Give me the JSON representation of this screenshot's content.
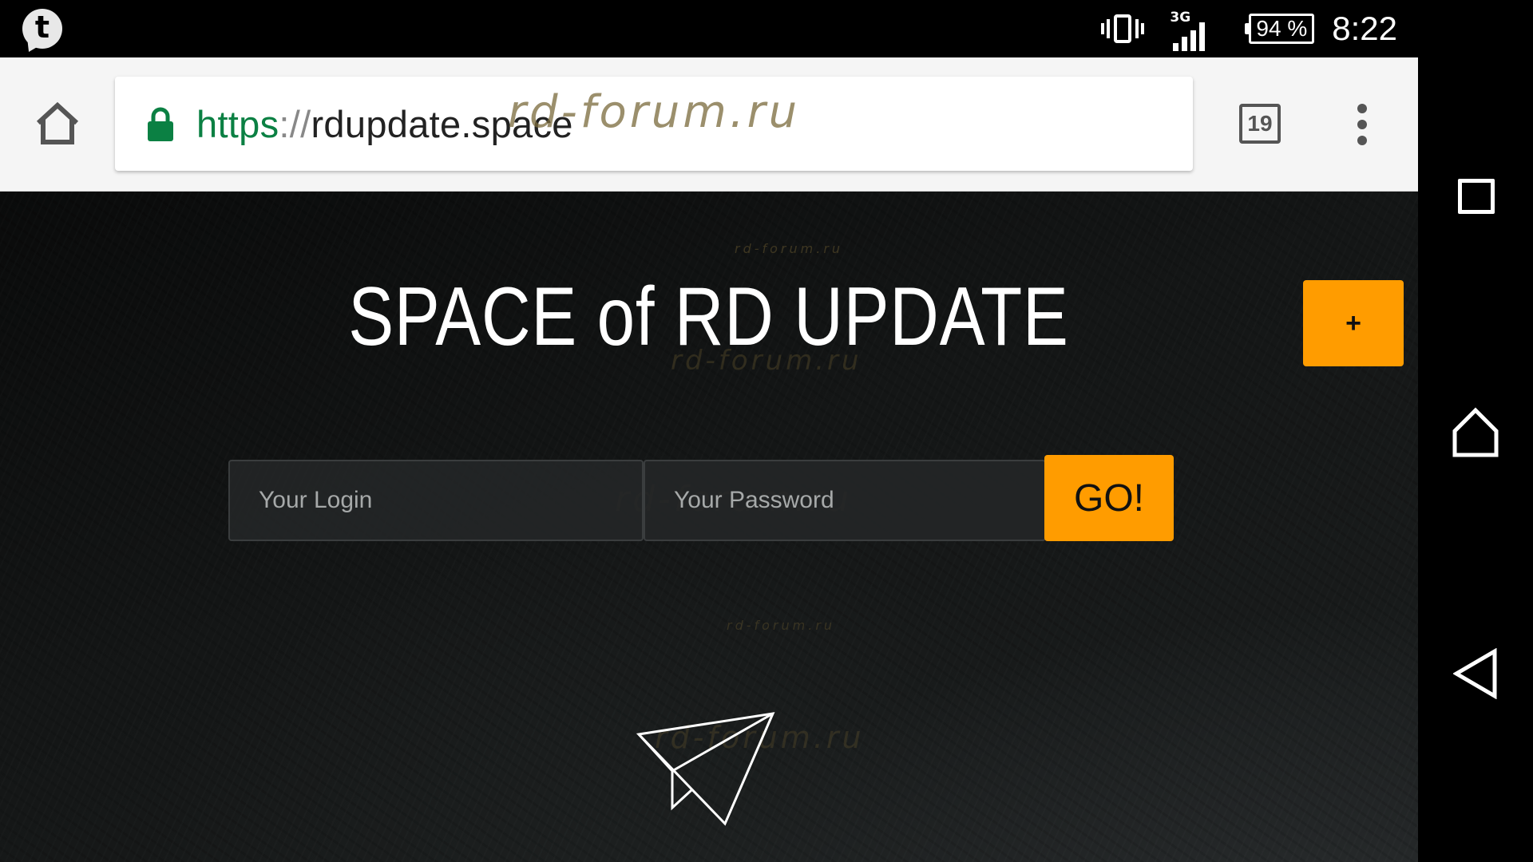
{
  "status_bar": {
    "notification_icon": "tumblr-icon",
    "network_type": "3G",
    "battery": "94 %",
    "time": "8:22"
  },
  "browser": {
    "url_scheme": "https",
    "url_separator": "://",
    "url_host": "rdupdate.space",
    "tab_count": "19",
    "watermark": "rd-forum.ru"
  },
  "page": {
    "title": "SPACE of RD UPDATE",
    "plus_button": "+",
    "login_placeholder": "Your Login",
    "password_placeholder": "Your Password",
    "go_button": "GO!",
    "watermark": "rd-forum.ru"
  },
  "colors": {
    "accent": "#ff9c00",
    "secure_green": "#0b8043"
  }
}
